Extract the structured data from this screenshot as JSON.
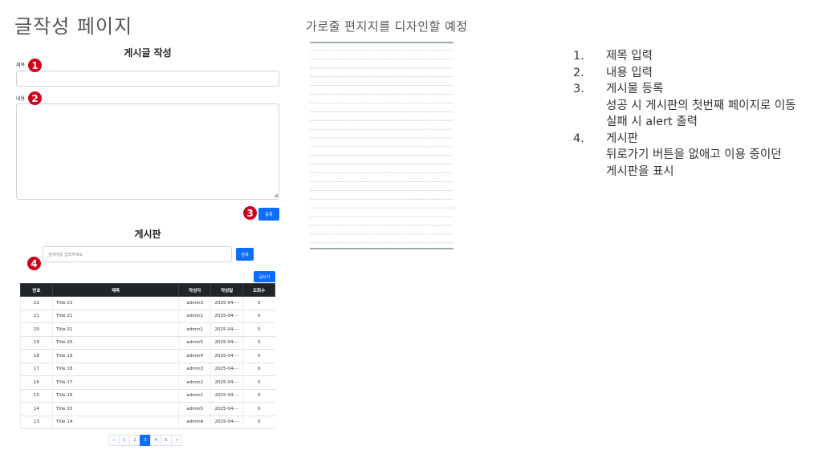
{
  "page_title": "글작성 페이지",
  "note_title": "가로줄 편지지를 디자인할 예정",
  "form": {
    "heading": "게시글 작성",
    "title_label": "제목",
    "content_label": "내용",
    "register_button": "등록"
  },
  "board": {
    "heading": "게시판",
    "search_placeholder": "검색어를 입력하세요",
    "search_button": "검색",
    "write_button": "글쓰기",
    "columns": [
      "번호",
      "제목",
      "작성자",
      "작성일",
      "조회수"
    ],
    "rows": [
      {
        "num": "22",
        "title": "Title 23",
        "author": "admin3",
        "date": "2025-04-···",
        "views": "0"
      },
      {
        "num": "21",
        "title": "Title 21",
        "author": "admin1",
        "date": "2025-04-···",
        "views": "0"
      },
      {
        "num": "20",
        "title": "Title 21",
        "author": "admin1",
        "date": "2025-04-···",
        "views": "0"
      },
      {
        "num": "19",
        "title": "Title 20",
        "author": "admin5",
        "date": "2025-04-···",
        "views": "0"
      },
      {
        "num": "18",
        "title": "Title 19",
        "author": "admin4",
        "date": "2025-04-···",
        "views": "0"
      },
      {
        "num": "17",
        "title": "Title 18",
        "author": "admin3",
        "date": "2025-04-···",
        "views": "0"
      },
      {
        "num": "16",
        "title": "Title 17",
        "author": "admin2",
        "date": "2025-04-···",
        "views": "0"
      },
      {
        "num": "15",
        "title": "Title 16",
        "author": "admin1",
        "date": "2025-04-···",
        "views": "0"
      },
      {
        "num": "14",
        "title": "Title 15",
        "author": "admin5",
        "date": "2025-04-···",
        "views": "0"
      },
      {
        "num": "13",
        "title": "Title 14",
        "author": "admin4",
        "date": "2025-04-···",
        "views": "0"
      }
    ],
    "pagination": [
      "«",
      "1",
      "2",
      "3",
      "4",
      "5",
      "»"
    ],
    "active_page": "3"
  },
  "markers": [
    "1",
    "2",
    "3",
    "4"
  ],
  "notes": [
    {
      "num": "1.",
      "text": "제목 입력",
      "sub": []
    },
    {
      "num": "2.",
      "text": "내용 입력",
      "sub": []
    },
    {
      "num": "3.",
      "text": "게시물 등록",
      "sub": [
        "성공 시 게시판의 첫번째 페이지로 이동",
        "실패 시 alert 출력"
      ]
    },
    {
      "num": "4.",
      "text": "게시판",
      "sub": [
        "뒤로가기 버튼을 없애고 이용 중이던",
        "게시판을 표시"
      ]
    }
  ],
  "colors": {
    "primary": "#0d6efd",
    "marker": "#d0021b",
    "table_header": "#212529",
    "paper_border": "#7d8a93",
    "paper_line": "#c4c8cc"
  }
}
